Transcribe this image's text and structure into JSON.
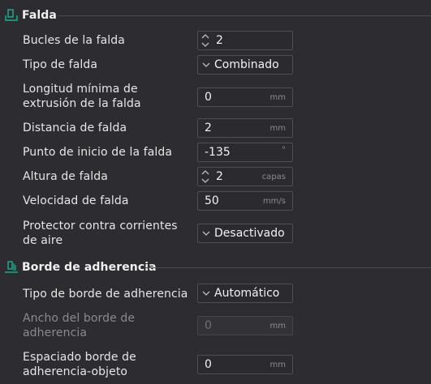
{
  "sections": {
    "skirt": {
      "title": "Falda",
      "icon": "skirt-icon",
      "rows": {
        "loops": {
          "label": "Bucles de la falda",
          "value": "2"
        },
        "type": {
          "label": "Tipo de falda",
          "value": "Combinado"
        },
        "min_extrusion": {
          "label": "Longitud mínima de extrusión de la falda",
          "value": "0",
          "unit": "mm"
        },
        "distance": {
          "label": "Distancia de falda",
          "value": "2",
          "unit": "mm"
        },
        "start_point": {
          "label": "Punto de inicio de la falda",
          "value": "-135",
          "unit": "°"
        },
        "height": {
          "label": "Altura de falda",
          "value": "2",
          "unit": "capas"
        },
        "speed": {
          "label": "Velocidad de falda",
          "value": "50",
          "unit": "mm/s"
        },
        "draft_shield": {
          "label": "Protector contra corrientes de aire",
          "value": "Desactivado"
        }
      }
    },
    "brim": {
      "title": "Borde de adherencia",
      "icon": "brim-icon",
      "rows": {
        "type": {
          "label": "Tipo de borde de adherencia",
          "value": "Automático"
        },
        "width": {
          "label": "Ancho del borde de adherencia",
          "value": "0",
          "unit": "mm"
        },
        "object_gap": {
          "label": "Espaciado borde de adherencia-objeto",
          "value": "0",
          "unit": "mm"
        }
      }
    }
  },
  "colors": {
    "background": "#2d2d31",
    "field_border": "#4d4d53",
    "accent": "#19b394"
  }
}
